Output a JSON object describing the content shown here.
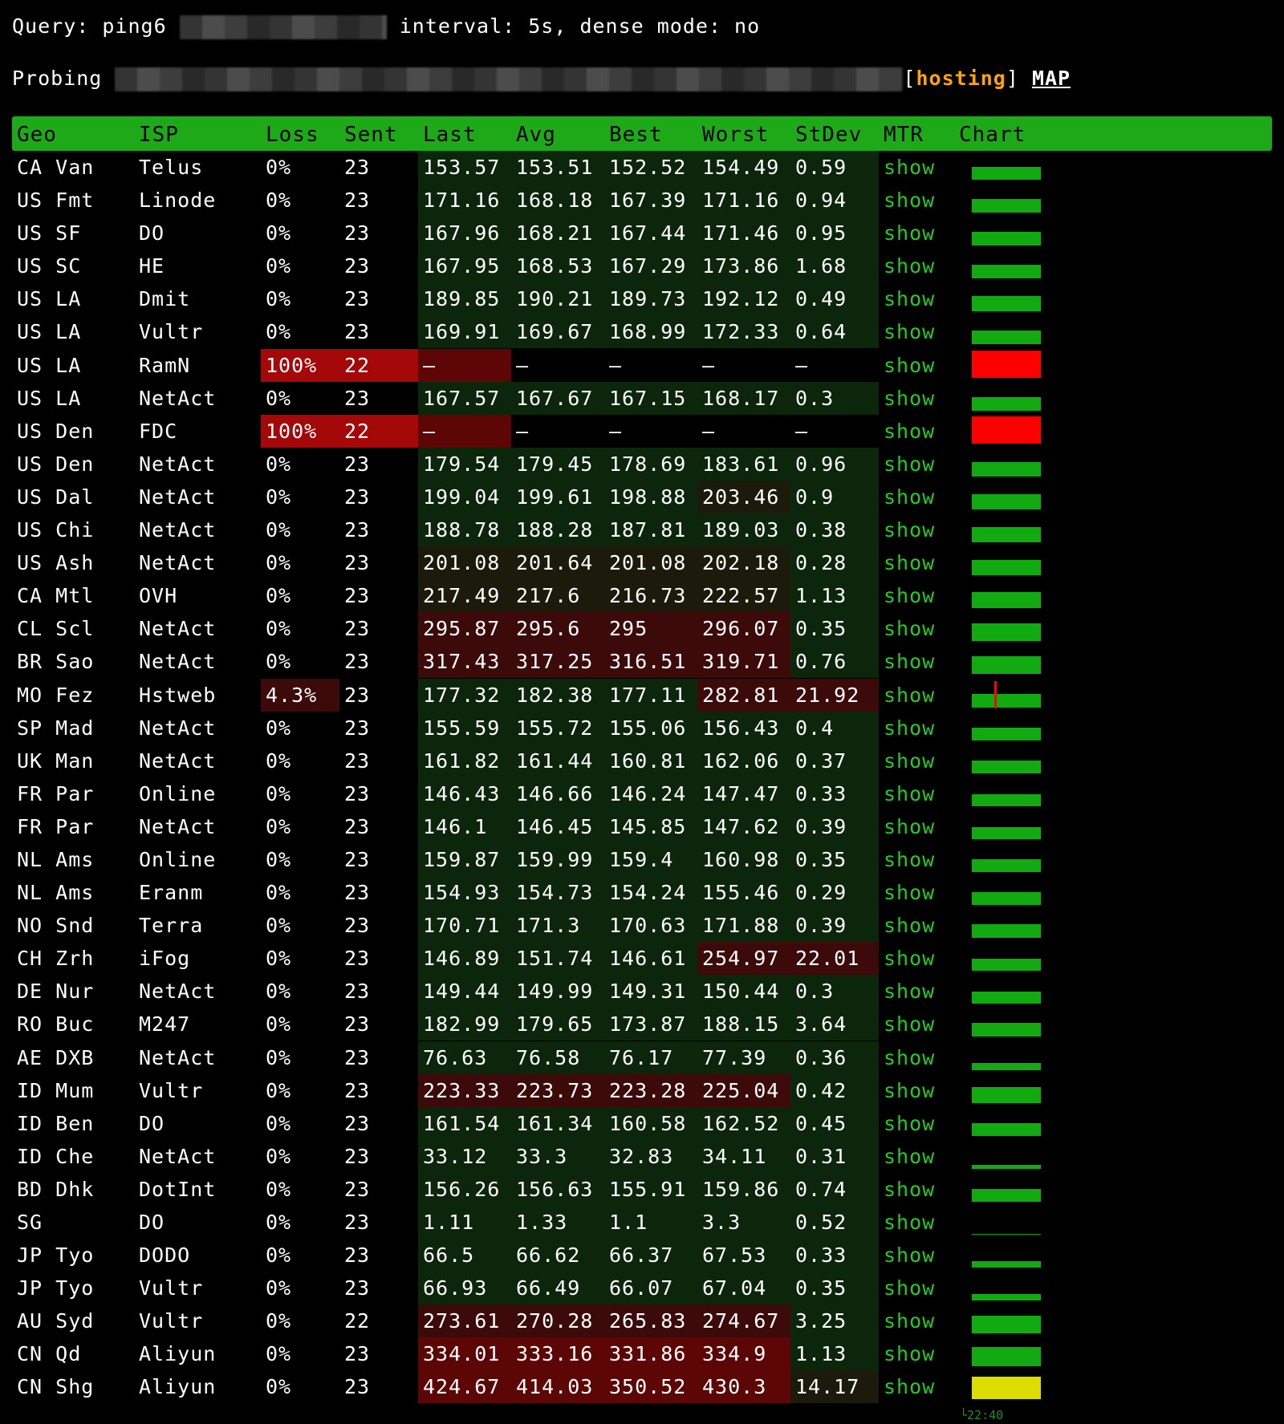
{
  "query": {
    "prefix": "Query: ping6 ",
    "suffix": " interval: 5s, dense mode: no"
  },
  "probe": {
    "label": "Probing ",
    "tag_open": "[",
    "tag": "hosting",
    "tag_close": "] ",
    "map": "MAP"
  },
  "columns": [
    "Geo",
    "ISP",
    "Loss",
    "Sent",
    "Last",
    "Avg",
    "Best",
    "Worst",
    "StDev",
    "MTR",
    "Chart"
  ],
  "colors": {
    "header_bg": "#1eaa18",
    "link_green": "#22cc22",
    "good_bg": "#0c260c",
    "mid_bg": "#1c1a0a",
    "warn_bg": "#3d0a0a",
    "bad_bg": "#5c0606",
    "fail_bg": "#a40808",
    "chart_ok": "#11aa11",
    "chart_fail": "#ff0000",
    "chart_warn": "#dddd00"
  },
  "rows": [
    {
      "geo": "CA Van",
      "isp": "Telus",
      "loss": "0%",
      "sent": "23",
      "last": "153.57",
      "avg": "153.51",
      "best": "152.52",
      "worst": "154.49",
      "std": "0.59",
      "mtr": "show",
      "lt": "g",
      "wt": "g",
      "st": "g",
      "chart": "ok",
      "h": 16
    },
    {
      "geo": "US Fmt",
      "isp": "Linode",
      "loss": "0%",
      "sent": "23",
      "last": "171.16",
      "avg": "168.18",
      "best": "167.39",
      "worst": "171.16",
      "std": "0.94",
      "mtr": "show",
      "lt": "g",
      "wt": "g",
      "st": "g",
      "chart": "ok",
      "h": 17
    },
    {
      "geo": "US SF",
      "isp": "DO",
      "loss": "0%",
      "sent": "23",
      "last": "167.96",
      "avg": "168.21",
      "best": "167.44",
      "worst": "171.46",
      "std": "0.95",
      "mtr": "show",
      "lt": "g",
      "wt": "g",
      "st": "g",
      "chart": "ok",
      "h": 17
    },
    {
      "geo": "US SC",
      "isp": "HE",
      "loss": "0%",
      "sent": "23",
      "last": "167.95",
      "avg": "168.53",
      "best": "167.29",
      "worst": "173.86",
      "std": "1.68",
      "mtr": "show",
      "lt": "g",
      "wt": "g",
      "st": "g",
      "chart": "ok",
      "h": 17
    },
    {
      "geo": "US LA",
      "isp": "Dmit",
      "loss": "0%",
      "sent": "23",
      "last": "189.85",
      "avg": "190.21",
      "best": "189.73",
      "worst": "192.12",
      "std": "0.49",
      "mtr": "show",
      "lt": "g",
      "wt": "g",
      "st": "g",
      "chart": "ok",
      "h": 19
    },
    {
      "geo": "US LA",
      "isp": "Vultr",
      "loss": "0%",
      "sent": "23",
      "last": "169.91",
      "avg": "169.67",
      "best": "168.99",
      "worst": "172.33",
      "std": "0.64",
      "mtr": "show",
      "lt": "g",
      "wt": "g",
      "st": "g",
      "chart": "ok",
      "h": 17
    },
    {
      "geo": "US LA",
      "isp": "RamN",
      "loss": "100%",
      "sent": "22",
      "last": "–",
      "avg": "–",
      "best": "–",
      "worst": "–",
      "std": "–",
      "mtr": "show",
      "lt": "fail",
      "wt": "n",
      "st": "n",
      "chart": "fail",
      "h": 34
    },
    {
      "geo": "US LA",
      "isp": "NetAct",
      "loss": "0%",
      "sent": "23",
      "last": "167.57",
      "avg": "167.67",
      "best": "167.15",
      "worst": "168.17",
      "std": "0.3",
      "mtr": "show",
      "lt": "g",
      "wt": "g",
      "st": "g",
      "chart": "ok",
      "h": 17
    },
    {
      "geo": "US Den",
      "isp": "FDC",
      "loss": "100%",
      "sent": "22",
      "last": "–",
      "avg": "–",
      "best": "–",
      "worst": "–",
      "std": "–",
      "mtr": "show",
      "lt": "fail",
      "wt": "n",
      "st": "n",
      "chart": "fail",
      "h": 34
    },
    {
      "geo": "US Den",
      "isp": "NetAct",
      "loss": "0%",
      "sent": "23",
      "last": "179.54",
      "avg": "179.45",
      "best": "178.69",
      "worst": "183.61",
      "std": "0.96",
      "mtr": "show",
      "lt": "g",
      "wt": "g",
      "st": "g",
      "chart": "ok",
      "h": 18
    },
    {
      "geo": "US Dal",
      "isp": "NetAct",
      "loss": "0%",
      "sent": "23",
      "last": "199.04",
      "avg": "199.61",
      "best": "198.88",
      "worst": "203.46",
      "std": "0.9",
      "mtr": "show",
      "lt": "g",
      "wt": "m",
      "st": "g",
      "chart": "ok",
      "h": 19
    },
    {
      "geo": "US Chi",
      "isp": "NetAct",
      "loss": "0%",
      "sent": "23",
      "last": "188.78",
      "avg": "188.28",
      "best": "187.81",
      "worst": "189.03",
      "std": "0.38",
      "mtr": "show",
      "lt": "g",
      "wt": "g",
      "st": "g",
      "chart": "ok",
      "h": 19
    },
    {
      "geo": "US Ash",
      "isp": "NetAct",
      "loss": "0%",
      "sent": "23",
      "last": "201.08",
      "avg": "201.64",
      "best": "201.08",
      "worst": "202.18",
      "std": "0.28",
      "mtr": "show",
      "lt": "m",
      "wt": "m",
      "st": "g",
      "chart": "ok",
      "h": 19
    },
    {
      "geo": "CA Mtl",
      "isp": "OVH",
      "loss": "0%",
      "sent": "23",
      "last": "217.49",
      "avg": "217.6",
      "best": "216.73",
      "worst": "222.57",
      "std": "1.13",
      "mtr": "show",
      "lt": "m",
      "wt": "m",
      "st": "g",
      "chart": "ok",
      "h": 20
    },
    {
      "geo": "CL Scl",
      "isp": "NetAct",
      "loss": "0%",
      "sent": "23",
      "last": "295.87",
      "avg": "295.6",
      "best": "295",
      "worst": "296.07",
      "std": "0.35",
      "mtr": "show",
      "lt": "w",
      "wt": "w",
      "st": "g",
      "chart": "ok",
      "h": 22
    },
    {
      "geo": "BR Sao",
      "isp": "NetAct",
      "loss": "0%",
      "sent": "23",
      "last": "317.43",
      "avg": "317.25",
      "best": "316.51",
      "worst": "319.71",
      "std": "0.76",
      "mtr": "show",
      "lt": "w",
      "wt": "w",
      "st": "g",
      "chart": "ok",
      "h": 22
    },
    {
      "geo": "MO Fez",
      "isp": "Hstweb",
      "loss": "4.3%",
      "sent": "23",
      "last": "177.32",
      "avg": "182.38",
      "best": "177.11",
      "worst": "282.81",
      "std": "21.92",
      "mtr": "show",
      "lt": "g",
      "wt": "w",
      "st": "w",
      "chart": "ok",
      "h": 17,
      "lossbg": "warn",
      "redspike": true
    },
    {
      "geo": "SP Mad",
      "isp": "NetAct",
      "loss": "0%",
      "sent": "23",
      "last": "155.59",
      "avg": "155.72",
      "best": "155.06",
      "worst": "156.43",
      "std": "0.4",
      "mtr": "show",
      "lt": "g",
      "wt": "g",
      "st": "g",
      "chart": "ok",
      "h": 16
    },
    {
      "geo": "UK Man",
      "isp": "NetAct",
      "loss": "0%",
      "sent": "23",
      "last": "161.82",
      "avg": "161.44",
      "best": "160.81",
      "worst": "162.06",
      "std": "0.37",
      "mtr": "show",
      "lt": "g",
      "wt": "g",
      "st": "g",
      "chart": "ok",
      "h": 16
    },
    {
      "geo": "FR Par",
      "isp": "Online",
      "loss": "0%",
      "sent": "23",
      "last": "146.43",
      "avg": "146.66",
      "best": "146.24",
      "worst": "147.47",
      "std": "0.33",
      "mtr": "show",
      "lt": "g",
      "wt": "g",
      "st": "g",
      "chart": "ok",
      "h": 15
    },
    {
      "geo": "FR Par",
      "isp": "NetAct",
      "loss": "0%",
      "sent": "23",
      "last": "146.1",
      "avg": "146.45",
      "best": "145.85",
      "worst": "147.62",
      "std": "0.39",
      "mtr": "show",
      "lt": "g",
      "wt": "g",
      "st": "g",
      "chart": "ok",
      "h": 15
    },
    {
      "geo": "NL Ams",
      "isp": "Online",
      "loss": "0%",
      "sent": "23",
      "last": "159.87",
      "avg": "159.99",
      "best": "159.4",
      "worst": "160.98",
      "std": "0.35",
      "mtr": "show",
      "lt": "g",
      "wt": "g",
      "st": "g",
      "chart": "ok",
      "h": 16
    },
    {
      "geo": "NL Ams",
      "isp": "Eranm",
      "loss": "0%",
      "sent": "23",
      "last": "154.93",
      "avg": "154.73",
      "best": "154.24",
      "worst": "155.46",
      "std": "0.29",
      "mtr": "show",
      "lt": "g",
      "wt": "g",
      "st": "g",
      "chart": "ok",
      "h": 16
    },
    {
      "geo": "NO Snd",
      "isp": "Terra",
      "loss": "0%",
      "sent": "23",
      "last": "170.71",
      "avg": "171.3",
      "best": "170.63",
      "worst": "171.88",
      "std": "0.39",
      "mtr": "show",
      "lt": "g",
      "wt": "g",
      "st": "g",
      "chart": "ok",
      "h": 17
    },
    {
      "geo": "CH Zrh",
      "isp": "iFog",
      "loss": "0%",
      "sent": "23",
      "last": "146.89",
      "avg": "151.74",
      "best": "146.61",
      "worst": "254.97",
      "std": "22.01",
      "mtr": "show",
      "lt": "g",
      "wt": "w",
      "st": "w",
      "chart": "ok",
      "h": 15
    },
    {
      "geo": "DE Nur",
      "isp": "NetAct",
      "loss": "0%",
      "sent": "23",
      "last": "149.44",
      "avg": "149.99",
      "best": "149.31",
      "worst": "150.44",
      "std": "0.3",
      "mtr": "show",
      "lt": "g",
      "wt": "g",
      "st": "g",
      "chart": "ok",
      "h": 15
    },
    {
      "geo": "RO Buc",
      "isp": "M247",
      "loss": "0%",
      "sent": "23",
      "last": "182.99",
      "avg": "179.65",
      "best": "173.87",
      "worst": "188.15",
      "std": "3.64",
      "mtr": "show",
      "lt": "g",
      "wt": "g",
      "st": "g",
      "chart": "ok",
      "h": 17
    },
    {
      "geo": "AE DXB",
      "isp": "NetAct",
      "loss": "0%",
      "sent": "23",
      "last": "76.63",
      "avg": "76.58",
      "best": "76.17",
      "worst": "77.39",
      "std": "0.36",
      "mtr": "show",
      "lt": "g",
      "wt": "g",
      "st": "g",
      "chart": "ok",
      "h": 9
    },
    {
      "geo": "ID Mum",
      "isp": "Vultr",
      "loss": "0%",
      "sent": "23",
      "last": "223.33",
      "avg": "223.73",
      "best": "223.28",
      "worst": "225.04",
      "std": "0.42",
      "mtr": "show",
      "lt": "w",
      "wt": "w",
      "st": "g",
      "chart": "ok",
      "h": 20
    },
    {
      "geo": "ID Ben",
      "isp": "DO",
      "loss": "0%",
      "sent": "23",
      "last": "161.54",
      "avg": "161.34",
      "best": "160.58",
      "worst": "162.52",
      "std": "0.45",
      "mtr": "show",
      "lt": "g",
      "wt": "g",
      "st": "g",
      "chart": "ok",
      "h": 16
    },
    {
      "geo": "ID Che",
      "isp": "NetAct",
      "loss": "0%",
      "sent": "23",
      "last": "33.12",
      "avg": "33.3",
      "best": "32.83",
      "worst": "34.11",
      "std": "0.31",
      "mtr": "show",
      "lt": "g",
      "wt": "g",
      "st": "g",
      "chart": "ok",
      "h": 5
    },
    {
      "geo": "BD Dhk",
      "isp": "DotInt",
      "loss": "0%",
      "sent": "23",
      "last": "156.26",
      "avg": "156.63",
      "best": "155.91",
      "worst": "159.86",
      "std": "0.74",
      "mtr": "show",
      "lt": "g",
      "wt": "g",
      "st": "g",
      "chart": "ok",
      "h": 16
    },
    {
      "geo": "SG",
      "isp": "DO",
      "loss": "0%",
      "sent": "23",
      "last": "1.11",
      "avg": "1.33",
      "best": "1.1",
      "worst": "3.3",
      "std": "0.52",
      "mtr": "show",
      "lt": "g",
      "wt": "g",
      "st": "g",
      "chart": "ok",
      "h": 1
    },
    {
      "geo": "JP Tyo",
      "isp": "DODO",
      "loss": "0%",
      "sent": "23",
      "last": "66.5",
      "avg": "66.62",
      "best": "66.37",
      "worst": "67.53",
      "std": "0.33",
      "mtr": "show",
      "lt": "g",
      "wt": "g",
      "st": "g",
      "chart": "ok",
      "h": 8
    },
    {
      "geo": "JP Tyo",
      "isp": "Vultr",
      "loss": "0%",
      "sent": "23",
      "last": "66.93",
      "avg": "66.49",
      "best": "66.07",
      "worst": "67.04",
      "std": "0.35",
      "mtr": "show",
      "lt": "g",
      "wt": "g",
      "st": "g",
      "chart": "ok",
      "h": 8
    },
    {
      "geo": "AU Syd",
      "isp": "Vultr",
      "loss": "0%",
      "sent": "22",
      "last": "273.61",
      "avg": "270.28",
      "best": "265.83",
      "worst": "274.67",
      "std": "3.25",
      "mtr": "show",
      "lt": "w",
      "wt": "w",
      "st": "g",
      "chart": "ok",
      "h": 22
    },
    {
      "geo": "CN Qd",
      "isp": "Aliyun",
      "loss": "0%",
      "sent": "23",
      "last": "334.01",
      "avg": "333.16",
      "best": "331.86",
      "worst": "334.9",
      "std": "1.13",
      "mtr": "show",
      "lt": "b",
      "wt": "b",
      "st": "g",
      "chart": "ok",
      "h": 24
    },
    {
      "geo": "CN Shg",
      "isp": "Aliyun",
      "loss": "0%",
      "sent": "23",
      "last": "424.67",
      "avg": "414.03",
      "best": "350.52",
      "worst": "430.3",
      "std": "14.17",
      "mtr": "show",
      "lt": "b",
      "wt": "b",
      "st": "m",
      "chart": "warn",
      "h": 28
    }
  ],
  "chart_time": "└22:40"
}
